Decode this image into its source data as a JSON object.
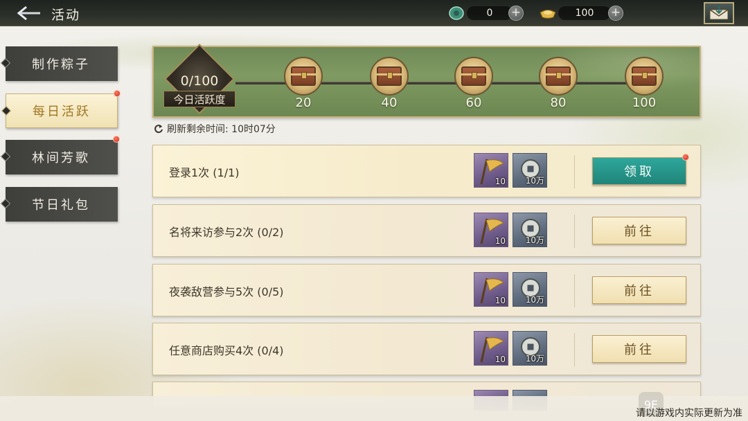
{
  "header": {
    "title": "活动",
    "currencies": [
      {
        "icon": "jade-gem-icon",
        "value": "0"
      },
      {
        "icon": "gold-ingot-icon",
        "value": "100"
      }
    ]
  },
  "sidebar": {
    "tabs": [
      {
        "label": "制作粽子",
        "active": false,
        "badge": false
      },
      {
        "label": "每日活跃",
        "active": true,
        "badge": true
      },
      {
        "label": "林间芳歌",
        "active": false,
        "badge": true
      },
      {
        "label": "节日礼包",
        "active": false,
        "badge": false
      }
    ]
  },
  "activity": {
    "progress": "0/100",
    "progress_value": 0,
    "progress_max": 100,
    "label": "今日活跃度",
    "milestones": [
      "20",
      "40",
      "60",
      "80",
      "100"
    ],
    "refresh_text": "刷新剩余时间: 10时07分"
  },
  "tasks": [
    {
      "text": "登录1次 (1/1)",
      "reward1": "10",
      "reward2": "10万",
      "button": "领取",
      "claimable": true
    },
    {
      "text": "名将来访参与2次 (0/2)",
      "reward1": "10",
      "reward2": "10万",
      "button": "前往",
      "claimable": false
    },
    {
      "text": "夜袭敌营参与5次 (0/5)",
      "reward1": "10",
      "reward2": "10万",
      "button": "前往",
      "claimable": false
    },
    {
      "text": "任意商店购买4次 (0/4)",
      "reward1": "10",
      "reward2": "10万",
      "button": "前往",
      "claimable": false
    }
  ],
  "footer": {
    "note": "请以游戏内实际更新为准",
    "watermark": "9E"
  },
  "colors": {
    "claim_button": "#1f8479",
    "banner_green": "#7f9a62",
    "active_tab": "#f0e2b3"
  }
}
